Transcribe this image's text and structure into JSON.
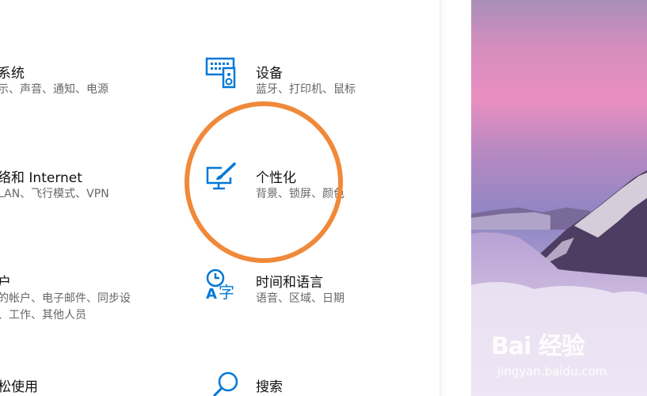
{
  "settings": {
    "tiles": [
      {
        "title": "系统",
        "desc": [
          "示、声音、通知、电源"
        ]
      },
      {
        "title": "设备",
        "desc": [
          "蓝牙、打印机、鼠标"
        ]
      },
      {
        "title": "络和 Internet",
        "desc": [
          "LAN、飞行模式、VPN"
        ]
      },
      {
        "title": "个性化",
        "desc": [
          "背景、锁屏、颜色"
        ]
      },
      {
        "title": "户",
        "desc": [
          "的帐户、电子邮件、同步设",
          "、工作、其他人员"
        ]
      },
      {
        "title": "时间和语言",
        "desc": [
          "语音、区域、日期"
        ]
      },
      {
        "title": "松使用",
        "desc": []
      },
      {
        "title": "搜索",
        "desc": []
      }
    ]
  },
  "annotation": {
    "color": "#f0893a"
  },
  "watermark": {
    "logo": "Bai 经验",
    "url": "jingyan.baidu.com"
  },
  "accent_color": "#0078d7"
}
